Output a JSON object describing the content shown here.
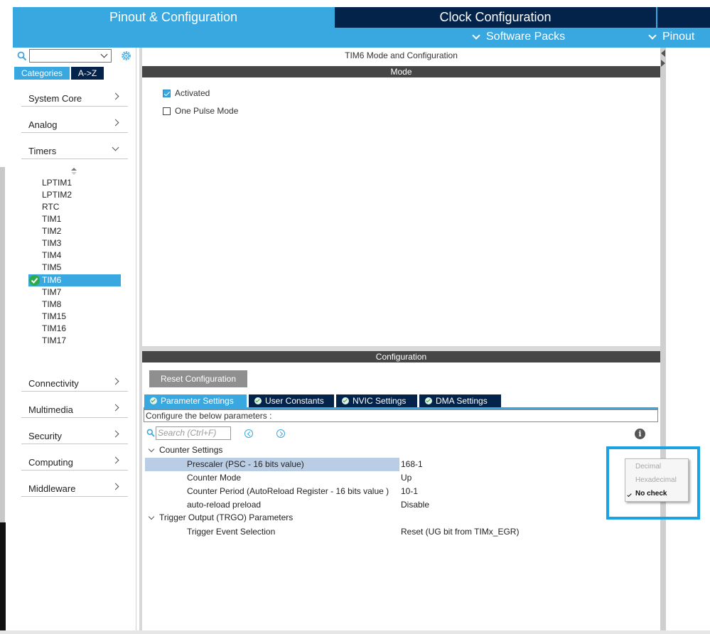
{
  "header": {
    "tab_pinout": "Pinout & Configuration",
    "tab_clock": "Clock Configuration",
    "software_packs": "Software Packs",
    "pinout": "Pinout"
  },
  "sidebar": {
    "tabs": [
      "Categories",
      "A->Z"
    ],
    "categories": [
      {
        "label": "System Core"
      },
      {
        "label": "Analog"
      },
      {
        "label": "Timers"
      },
      {
        "label": "Connectivity"
      },
      {
        "label": "Multimedia"
      },
      {
        "label": "Security"
      },
      {
        "label": "Computing"
      },
      {
        "label": "Middleware"
      }
    ],
    "timers": [
      "LPTIM1",
      "LPTIM2",
      "RTC",
      "TIM1",
      "TIM2",
      "TIM3",
      "TIM4",
      "TIM5",
      "TIM6",
      "TIM7",
      "TIM8",
      "TIM15",
      "TIM16",
      "TIM17"
    ],
    "selected_timer": "TIM6"
  },
  "mode_panel": {
    "title": "TIM6 Mode and Configuration",
    "section": "Mode",
    "options": [
      {
        "label": "Activated",
        "checked": true
      },
      {
        "label": "One Pulse Mode",
        "checked": false
      }
    ]
  },
  "config_panel": {
    "section": "Configuration",
    "reset_label": "Reset Configuration",
    "tabs": [
      "Parameter Settings",
      "User Constants",
      "NVIC Settings",
      "DMA Settings"
    ],
    "active_tab": "Parameter Settings",
    "hint": "Configure the below parameters :",
    "search_placeholder": "Search (Ctrl+F)",
    "groups": [
      {
        "title": "Counter Settings",
        "params": [
          {
            "name": "Prescaler (PSC - 16 bits value)",
            "value": "168-1"
          },
          {
            "name": "Counter Mode",
            "value": "Up"
          },
          {
            "name": "Counter Period (AutoReload Register - 16 bits value )",
            "value": "10-1"
          },
          {
            "name": "auto-reload preload",
            "value": "Disable"
          }
        ]
      },
      {
        "title": "Trigger Output (TRGO) Parameters",
        "params": [
          {
            "name": "Trigger Event Selection",
            "value": "Reset (UG bit from TIMx_EGR)"
          }
        ]
      }
    ]
  },
  "context_menu": {
    "items": [
      "Decimal",
      "Hexadecimal",
      "No check"
    ],
    "checked": "No check"
  },
  "colors": {
    "accent": "#3aa8e0",
    "navy": "#03234b",
    "highlight": "#1aa3e3"
  },
  "icons": [
    "search-icon",
    "gear-icon",
    "chevron-right-icon",
    "chevron-down-icon",
    "check-circle-icon",
    "info-icon"
  ]
}
